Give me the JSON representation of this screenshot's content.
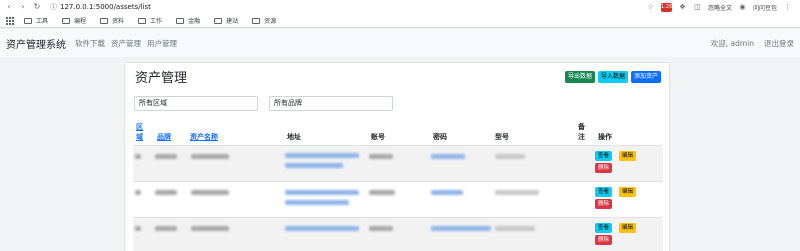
{
  "browser": {
    "url": "127.0.0.1:5000/assets/list",
    "bookmarks": [
      "工具",
      "编程",
      "资料",
      "工作",
      "金融",
      "建站",
      "资源"
    ],
    "right_texts": [
      "忽略全文",
      "问问豆包"
    ],
    "ext_badge": "1:26"
  },
  "app": {
    "brand": "资产管理系统",
    "nav_links": [
      "软件下载",
      "资产管理",
      "用户管理"
    ],
    "greeting": "欢迎, admin",
    "logout": "退出登录"
  },
  "page": {
    "title": "资产管理",
    "export_label": "导出数据",
    "import_label": "导入数据",
    "add_label": "添加资产",
    "region_select": "所有区域",
    "brand_select": "所有品牌"
  },
  "table": {
    "headers": {
      "region": "区域",
      "brand": "品牌",
      "asset_name": "资产名称",
      "address": "地址",
      "account": "账号",
      "password": "密码",
      "model": "型号",
      "remark": "备注",
      "actions": "操作"
    },
    "row_actions": {
      "view": "查看",
      "edit": "编辑",
      "delete": "删除"
    }
  },
  "colors": {
    "success": "#198754",
    "info": "#0dcaf0",
    "primary": "#0d6efd",
    "warning": "#ffc107",
    "danger": "#dc3545"
  }
}
